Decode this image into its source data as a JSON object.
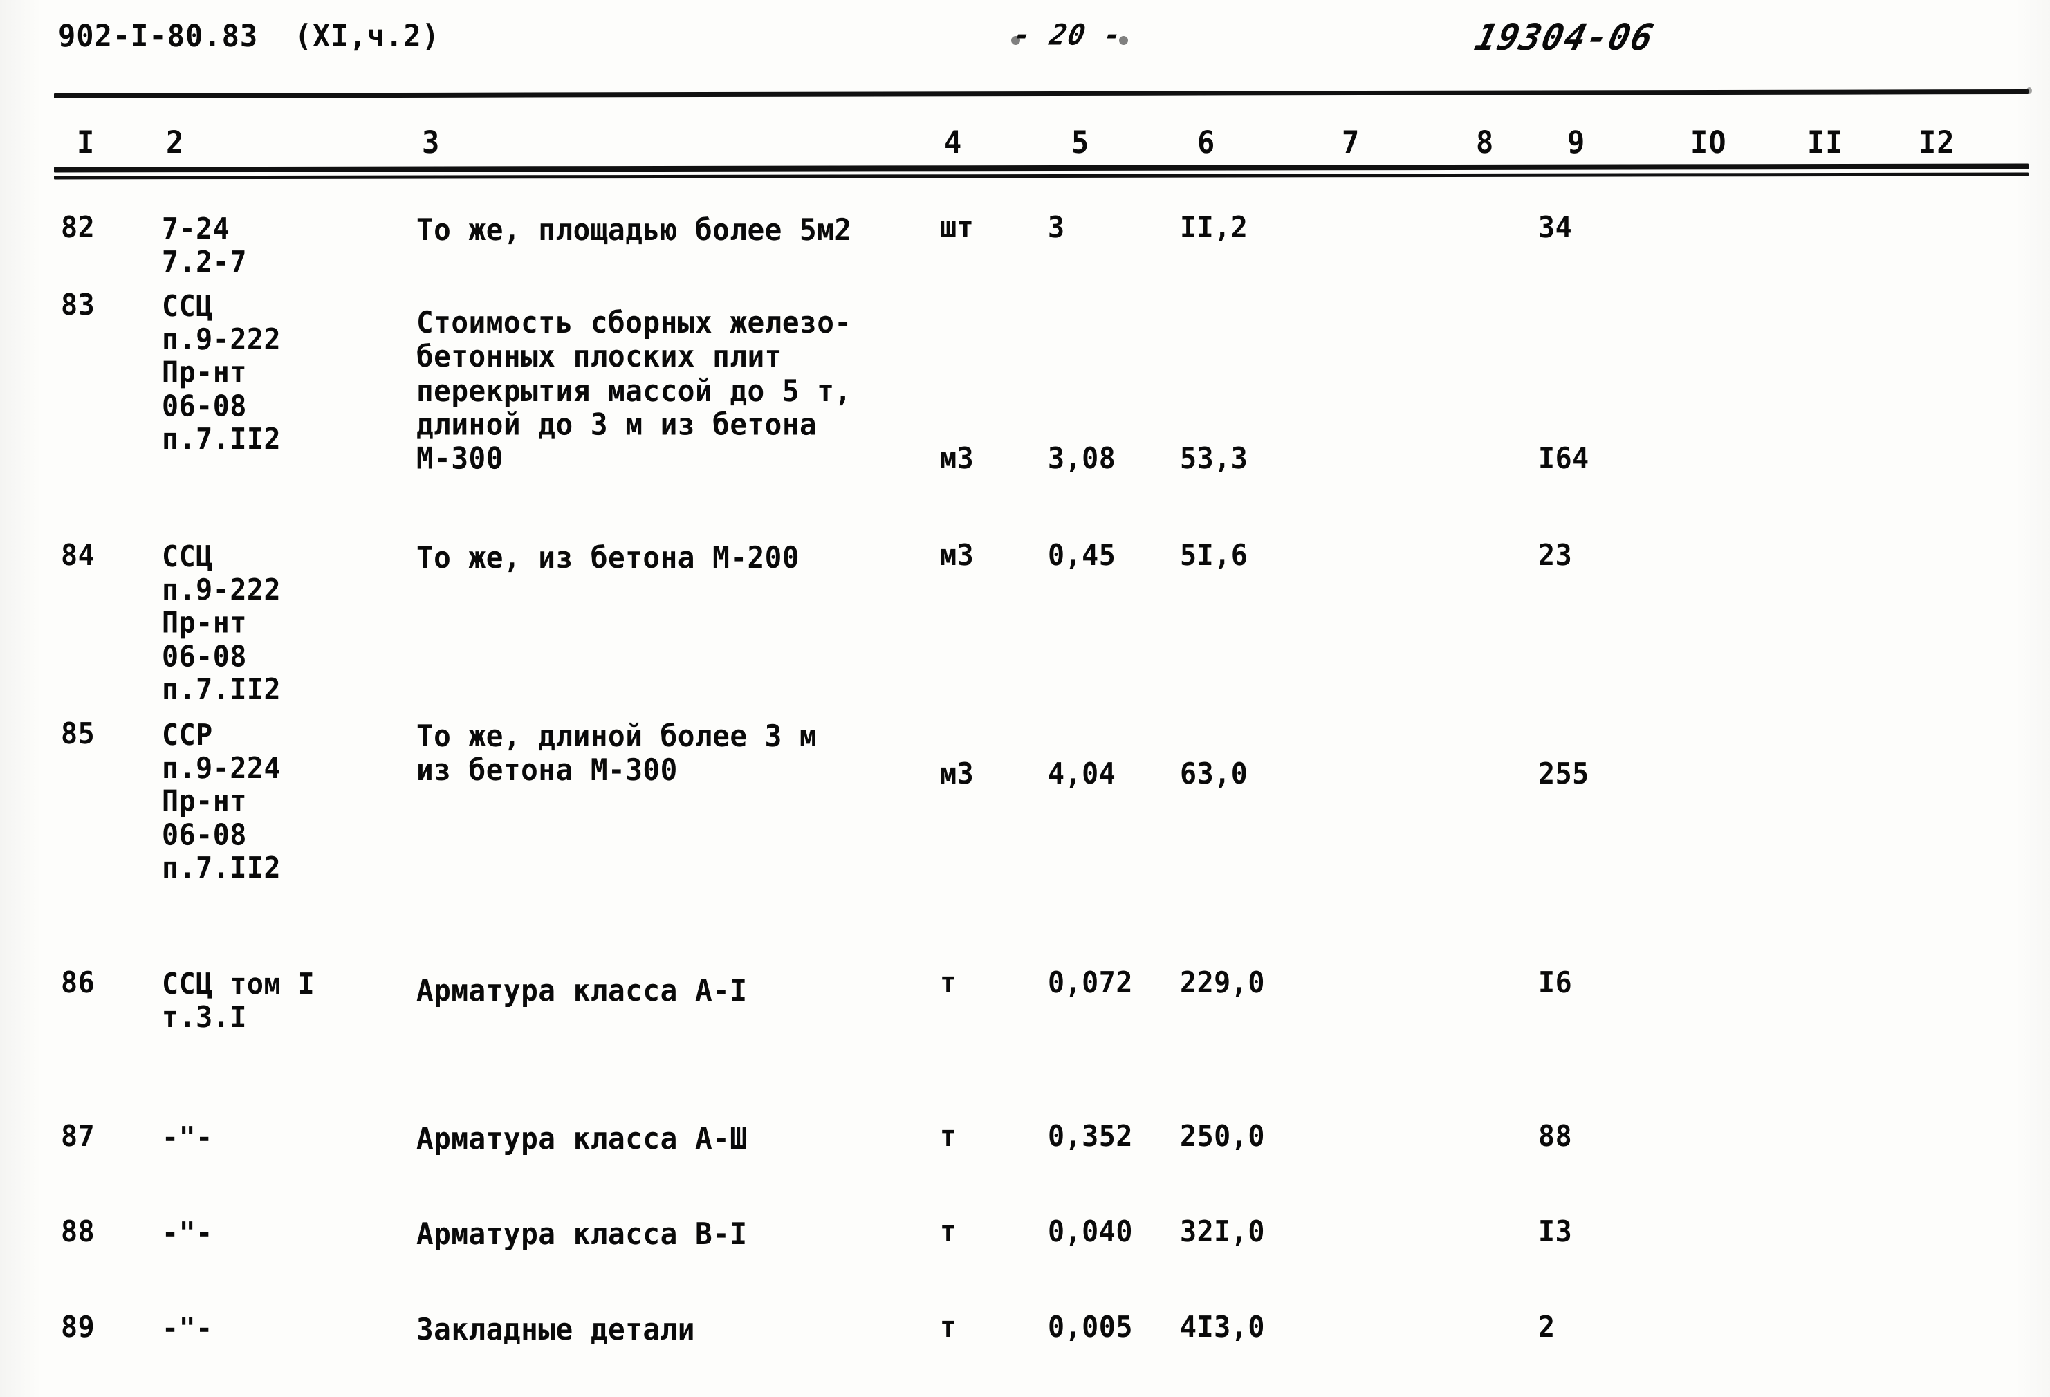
{
  "header": {
    "document_number": "902-I-80.83  (XI,ч.2)",
    "page_marker": "- 20 -",
    "sheet_code": "19304-06"
  },
  "table": {
    "column_numbers": [
      "I",
      "2",
      "3",
      "4",
      "5",
      "6",
      "7",
      "8",
      "9",
      "IO",
      "II",
      "I2"
    ],
    "rows": [
      {
        "num": "82",
        "ref": "7-24\n7.2-7",
        "desc": "То же, площадью более 5м2",
        "unit": "шт",
        "qty": "3",
        "price": "II,2",
        "col7": "",
        "col8": "",
        "total": "34",
        "col10": "",
        "col11": "",
        "col12": ""
      },
      {
        "num": "83",
        "ref": "ССЦ\nп.9-222\nПр-нт\n06-08\nп.7.II2",
        "desc": "Стоимость сборных железо-\nбетонных плоских плит\nперекрытия массой до 5 т,\nдлиной до 3 м из бетона\nМ-300",
        "unit": "м3",
        "qty": "3,08",
        "price": "53,3",
        "col7": "",
        "col8": "",
        "total": "I64",
        "col10": "",
        "col11": "",
        "col12": ""
      },
      {
        "num": "84",
        "ref": "ССЦ\nп.9-222\nПр-нт\n06-08\nп.7.II2",
        "desc": "То же, из бетона М-200",
        "unit": "м3",
        "qty": "0,45",
        "price": "5I,6",
        "col7": "",
        "col8": "",
        "total": "23",
        "col10": "",
        "col11": "",
        "col12": ""
      },
      {
        "num": "85",
        "ref": "ССР\nп.9-224\nПр-нт\n06-08\nп.7.II2",
        "desc": "То же, длиной более 3 м\nиз бетона М-300",
        "unit": "м3",
        "qty": "4,04",
        "price": "63,0",
        "col7": "",
        "col8": "",
        "total": "255",
        "col10": "",
        "col11": "",
        "col12": ""
      },
      {
        "num": "86",
        "ref": "ССЦ том I\nт.3.I",
        "desc": "Арматура класса А-I",
        "unit": "т",
        "qty": "0,072",
        "price": "229,0",
        "col7": "",
        "col8": "",
        "total": "I6",
        "col10": "",
        "col11": "",
        "col12": ""
      },
      {
        "num": "87",
        "ref": "-\"-",
        "desc": "Арматура класса А-Ш",
        "unit": "т",
        "qty": "0,352",
        "price": "250,0",
        "col7": "",
        "col8": "",
        "total": "88",
        "col10": "",
        "col11": "",
        "col12": ""
      },
      {
        "num": "88",
        "ref": "-\"-",
        "desc": "Арматура класса В-I",
        "unit": "т",
        "qty": "0,040",
        "price": "32I,0",
        "col7": "",
        "col8": "",
        "total": "I3",
        "col10": "",
        "col11": "",
        "col12": ""
      },
      {
        "num": "89",
        "ref": "-\"-",
        "desc": "Закладные детали",
        "unit": "т",
        "qty": "0,005",
        "price": "4I3,0",
        "col7": "",
        "col8": "",
        "total": "2",
        "col10": "",
        "col11": "",
        "col12": ""
      }
    ]
  }
}
